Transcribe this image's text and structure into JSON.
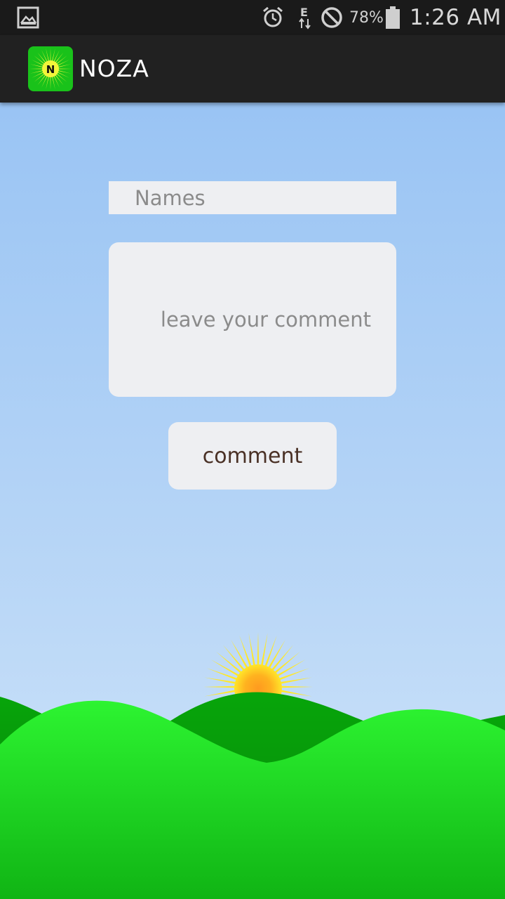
{
  "status_bar": {
    "battery_percent": "78%",
    "time": "1:26 AM",
    "icons": [
      "gallery-icon",
      "alarm-icon",
      "data-transfer-icon",
      "do-not-disturb-icon",
      "battery-icon"
    ]
  },
  "action_bar": {
    "title": "NOZA",
    "logo_letter": "N"
  },
  "form": {
    "names_placeholder": "Names",
    "comment_placeholder": "leave your comment",
    "submit_label": "comment"
  },
  "colors": {
    "sky_top": "#93c0f3",
    "hill_green": "#22e52a",
    "action_bar": "#212121",
    "field_bg": "#eeeff2"
  }
}
